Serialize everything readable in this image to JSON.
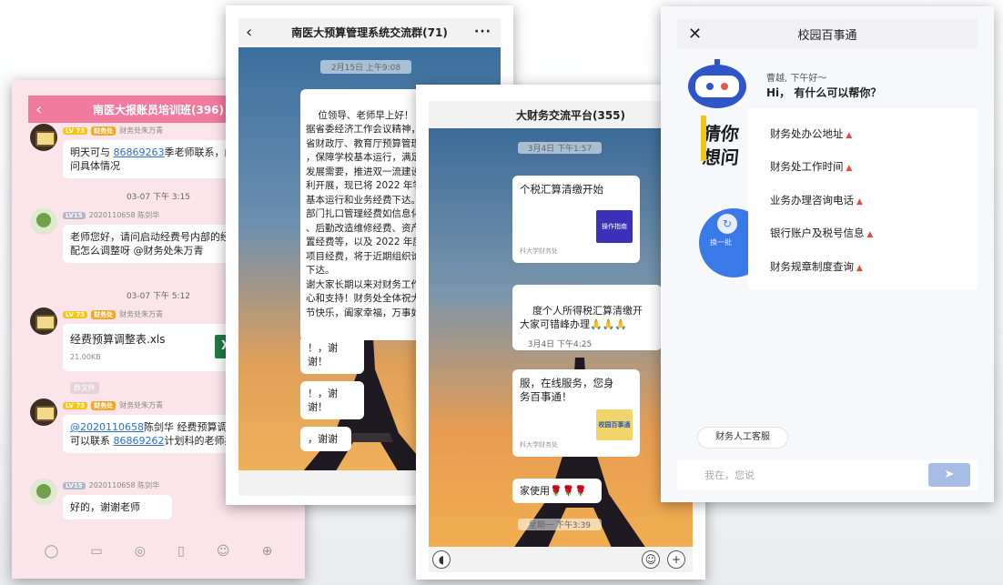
{
  "colors": {
    "pink": "#f07b9e",
    "pink_bg": "#fbe4ea",
    "sky": "#f0a557"
  },
  "phone1": {
    "title": "南医大报账员培训班(396)",
    "messages": [
      {
        "meta_lv": "LV 73",
        "meta_tag": "财务处",
        "meta_name": "财务处朱万青",
        "text_a": "明天可与 ",
        "phone": "86869263",
        "text_b": "季老师联系，问问具体情况"
      },
      {
        "time": "03-07 下午 3:15"
      },
      {
        "meta_lv": "LV15",
        "meta_name": "2020110658 陈剑华",
        "text": "老师您好，请问启动经费号内部的经费分配怎么调整呀 @财务处朱万青"
      },
      {
        "time": "03-07 下午 5:12"
      },
      {
        "meta_lv": "LV 73",
        "meta_tag": "财务处",
        "meta_name": "财务处朱万青",
        "file_name": "经费预算调整表.xls",
        "file_size": "21.00KB",
        "file_icon": "X"
      },
      {
        "recall": "群文件"
      },
      {
        "meta_lv": "LV 73",
        "meta_tag": "财务处",
        "meta_name": "财务处朱万青",
        "mention": "@2020110658",
        "text_c": "陈剑华 经费预算调整，可以联系 ",
        "phone2": "86869262",
        "text_d": "计划科的老师办理"
      },
      {
        "meta_lv": "LV15",
        "meta_name": "2020110658 陈剑华",
        "text": "好的，谢谢老师"
      }
    ]
  },
  "phone2": {
    "title": "南医大预算管理系统交流群(71)",
    "time": "2月15日 上午9:08",
    "announcement": "位领导、老师早上好！\n据省委经济工作会议精神，落\n省财政厅、教育厅预算管理要\n，保障学校基本运行，满足高\n发展需要，推进双一流建设\n利开展，现已将 2022 年学校\n基本运行和业务经费下达。\n部门扎口管理经费如信息化\n、后勤改造维修经费、资产\n置经费等，以及 2022 年度新\n项目经费，将于近期组织论证\n下达。\n谢大家长期以来对财务工作的\n心和支持！财务处全体祝大家\n节快乐，阖家幸福，万事如",
    "replies": [
      "！，谢谢！",
      "！，谢谢！",
      "，谢谢"
    ]
  },
  "phone3": {
    "title": "大财务交流平台(355)",
    "time1": "3月4日 下午1:57",
    "card1": "个税汇算清缴开始",
    "card1_badge": "操作指南",
    "card1_src": "科大学财务处",
    "notice": "度个人所得税汇算清缴开\n大家可错峰办理🙏🙏🙏",
    "time2": "3月4日 下午4:25",
    "card2": "服，在线服务，您身\n务百事通！",
    "card2_badge": "校园百事通",
    "card2_src": "科大学财务处",
    "use_msg": "家使用🌹🌹🌹",
    "time3": "星期一 下午3:39"
  },
  "phone4": {
    "title": "校园百事通",
    "greeting_name": "曹越, 下午好～",
    "greeting": "Hi， 有什么可以帮你？",
    "side_a": "猜你",
    "side_b": "想问",
    "side_c": "换一批",
    "faq": [
      "财务处办公地址",
      "财务处工作时间",
      "业务办理咨询电话",
      "银行账户及税号信息",
      "财务规章制度查询"
    ],
    "service_btn": "财务人工客服",
    "input_placeholder": "我在，您说"
  }
}
